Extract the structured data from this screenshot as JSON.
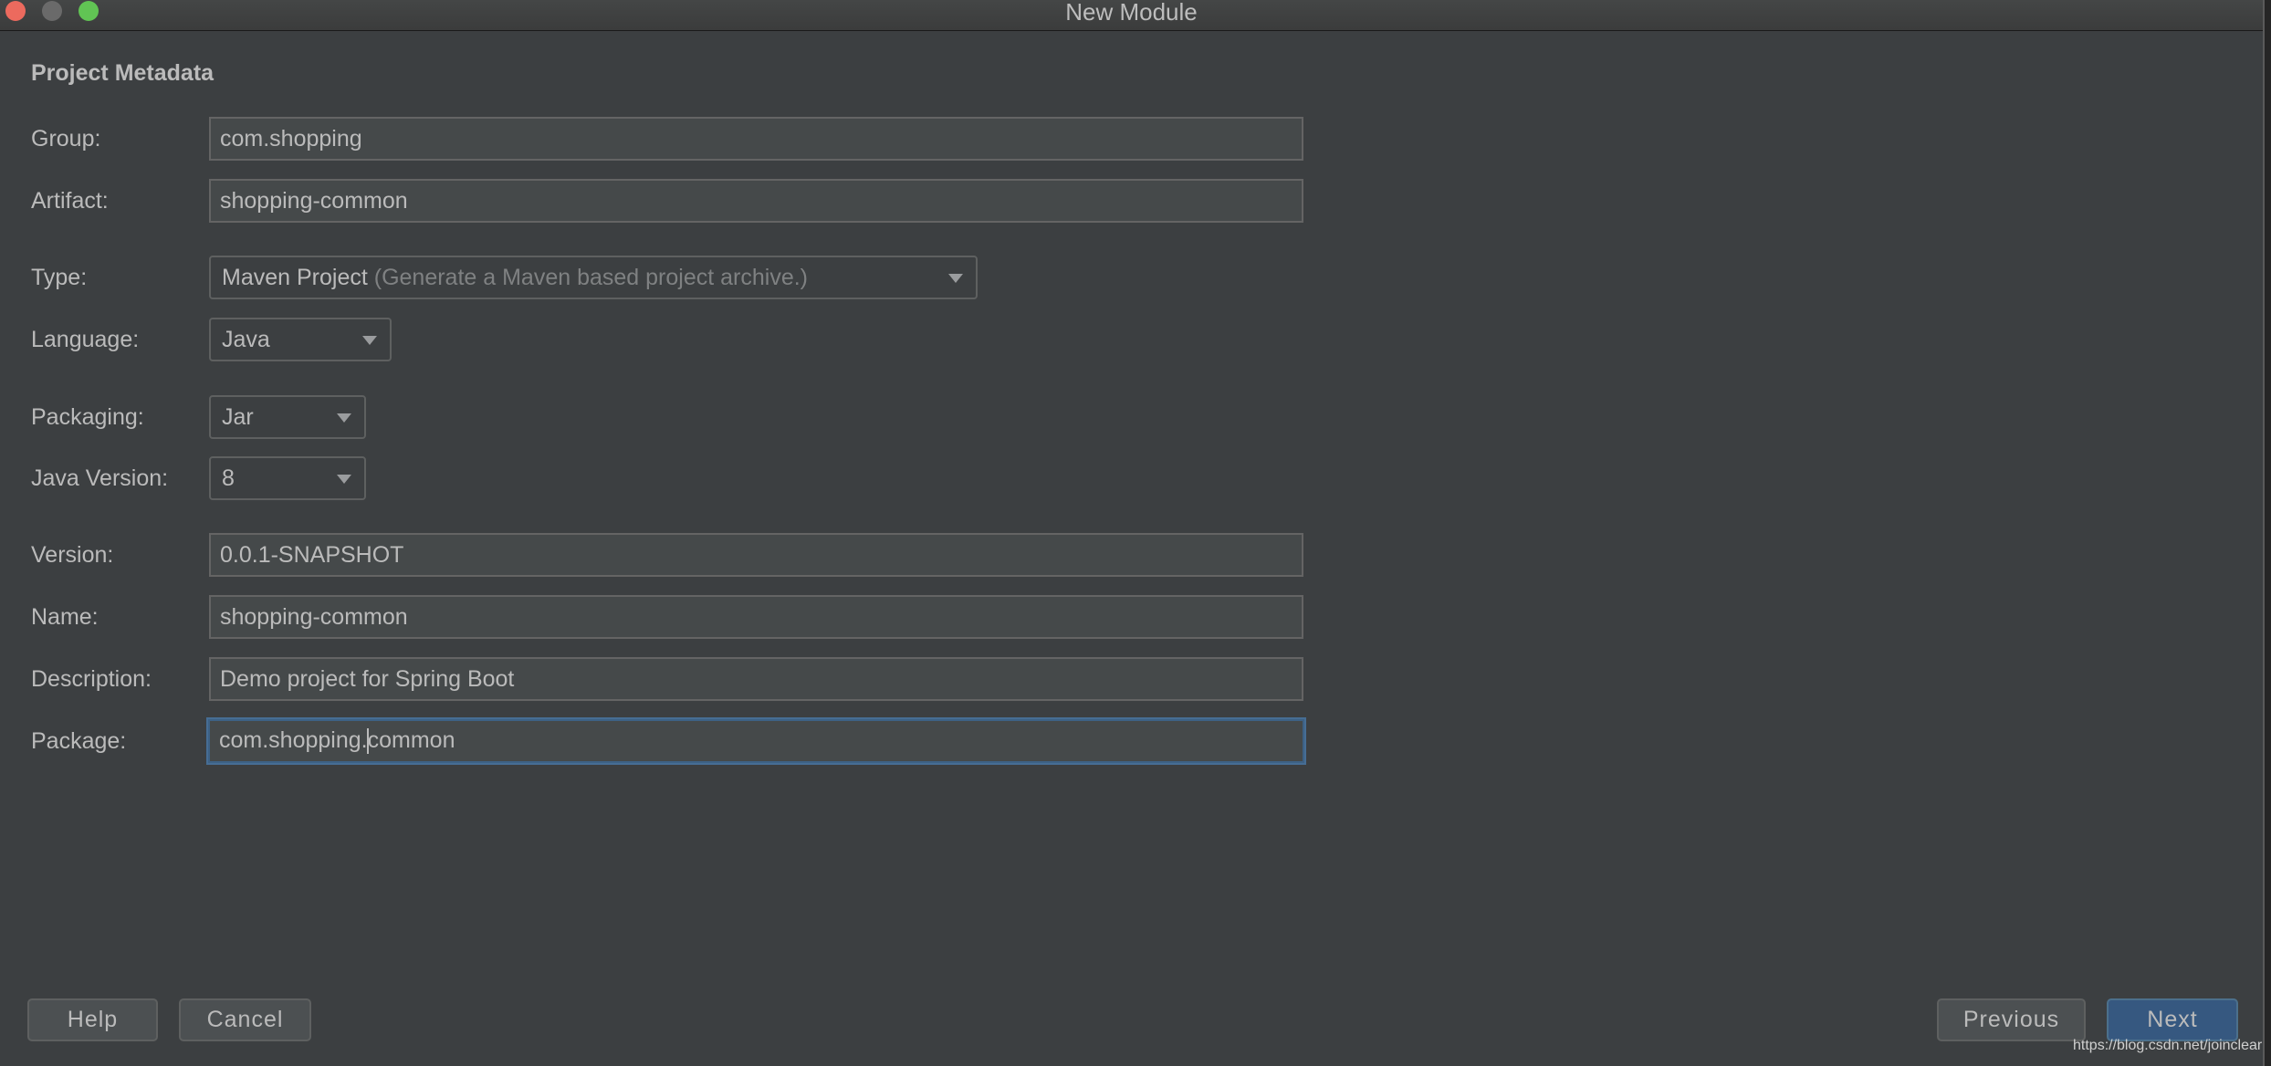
{
  "window": {
    "title": "New Module",
    "controls": [
      "close",
      "minimize",
      "maximize"
    ]
  },
  "section_title": "Project Metadata",
  "form": {
    "group": {
      "label": "Group:",
      "value": "com.shopping"
    },
    "artifact": {
      "label": "Artifact:",
      "value": "shopping-common"
    },
    "type": {
      "label": "Type:",
      "value": "Maven Project",
      "hint": "(Generate a Maven based project archive.)"
    },
    "language": {
      "label": "Language:",
      "value": "Java"
    },
    "packaging": {
      "label": "Packaging:",
      "value": "Jar"
    },
    "java_version": {
      "label": "Java Version:",
      "value": "8"
    },
    "version": {
      "label": "Version:",
      "value": "0.0.1-SNAPSHOT"
    },
    "name": {
      "label": "Name:",
      "value": "shopping-common"
    },
    "description": {
      "label": "Description:",
      "value": "Demo project for Spring Boot"
    },
    "package": {
      "label": "Package:",
      "value_before_caret": "com.shopping.",
      "value_after_caret": "common",
      "value": "com.shopping.common"
    }
  },
  "buttons": {
    "help": "Help",
    "cancel": "Cancel",
    "previous": "Previous",
    "next": "Next"
  },
  "watermark": "https://blog.csdn.net/joinclear",
  "colors": {
    "background": "#3c3f41",
    "field_bg": "#45494a",
    "focus": "#3d6185",
    "primary_button": "#365880"
  }
}
